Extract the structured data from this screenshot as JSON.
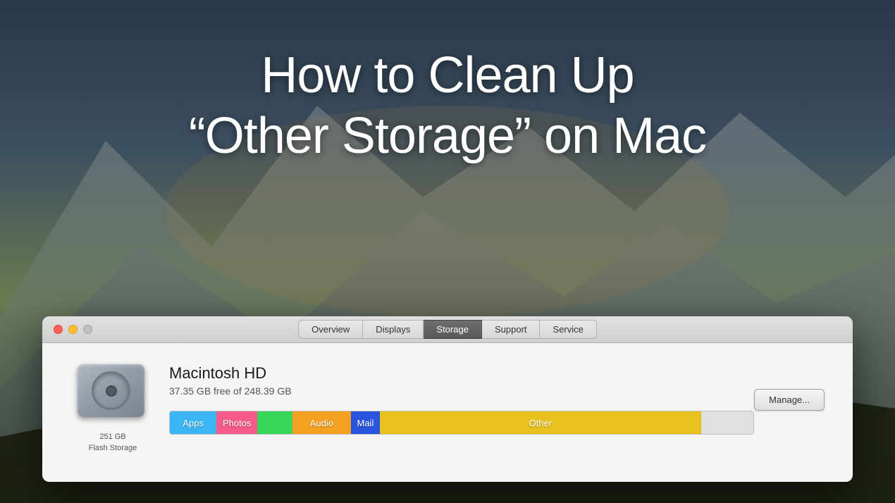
{
  "background": {
    "alt": "Mountain landscape background"
  },
  "title": {
    "line1": "How to Clean Up",
    "line2": "“Other Storage” on Mac"
  },
  "window": {
    "traffic_lights": {
      "close_label": "close",
      "minimize_label": "minimize",
      "zoom_label": "zoom"
    },
    "tabs": [
      {
        "id": "overview",
        "label": "Overview",
        "active": false
      },
      {
        "id": "displays",
        "label": "Displays",
        "active": false
      },
      {
        "id": "storage",
        "label": "Storage",
        "active": true
      },
      {
        "id": "support",
        "label": "Support",
        "active": false
      },
      {
        "id": "service",
        "label": "Service",
        "active": false
      }
    ],
    "drive": {
      "name": "Macintosh HD",
      "free_space": "37.35 GB free of 248.39 GB",
      "capacity_label": "251 GB",
      "type_label": "Flash Storage",
      "manage_button": "Manage...",
      "storage_bar": {
        "segments": [
          {
            "id": "apps",
            "label": "Apps",
            "color": "#3ab5f5",
            "width_pct": 8
          },
          {
            "id": "photos",
            "label": "Photos",
            "color": "#f55a8a",
            "width_pct": 7
          },
          {
            "id": "green",
            "label": "",
            "color": "#3ad65a",
            "width_pct": 5
          },
          {
            "id": "audio",
            "label": "Audio",
            "color": "#f5a020",
            "width_pct": 10
          },
          {
            "id": "mail",
            "label": "Mail",
            "color": "#2855e0",
            "width_pct": 5
          },
          {
            "id": "other",
            "label": "Other",
            "color": "#e8c020",
            "width_pct": 55
          },
          {
            "id": "free",
            "label": "",
            "color": "#e0e0e0",
            "width_pct": 10
          }
        ]
      }
    }
  }
}
